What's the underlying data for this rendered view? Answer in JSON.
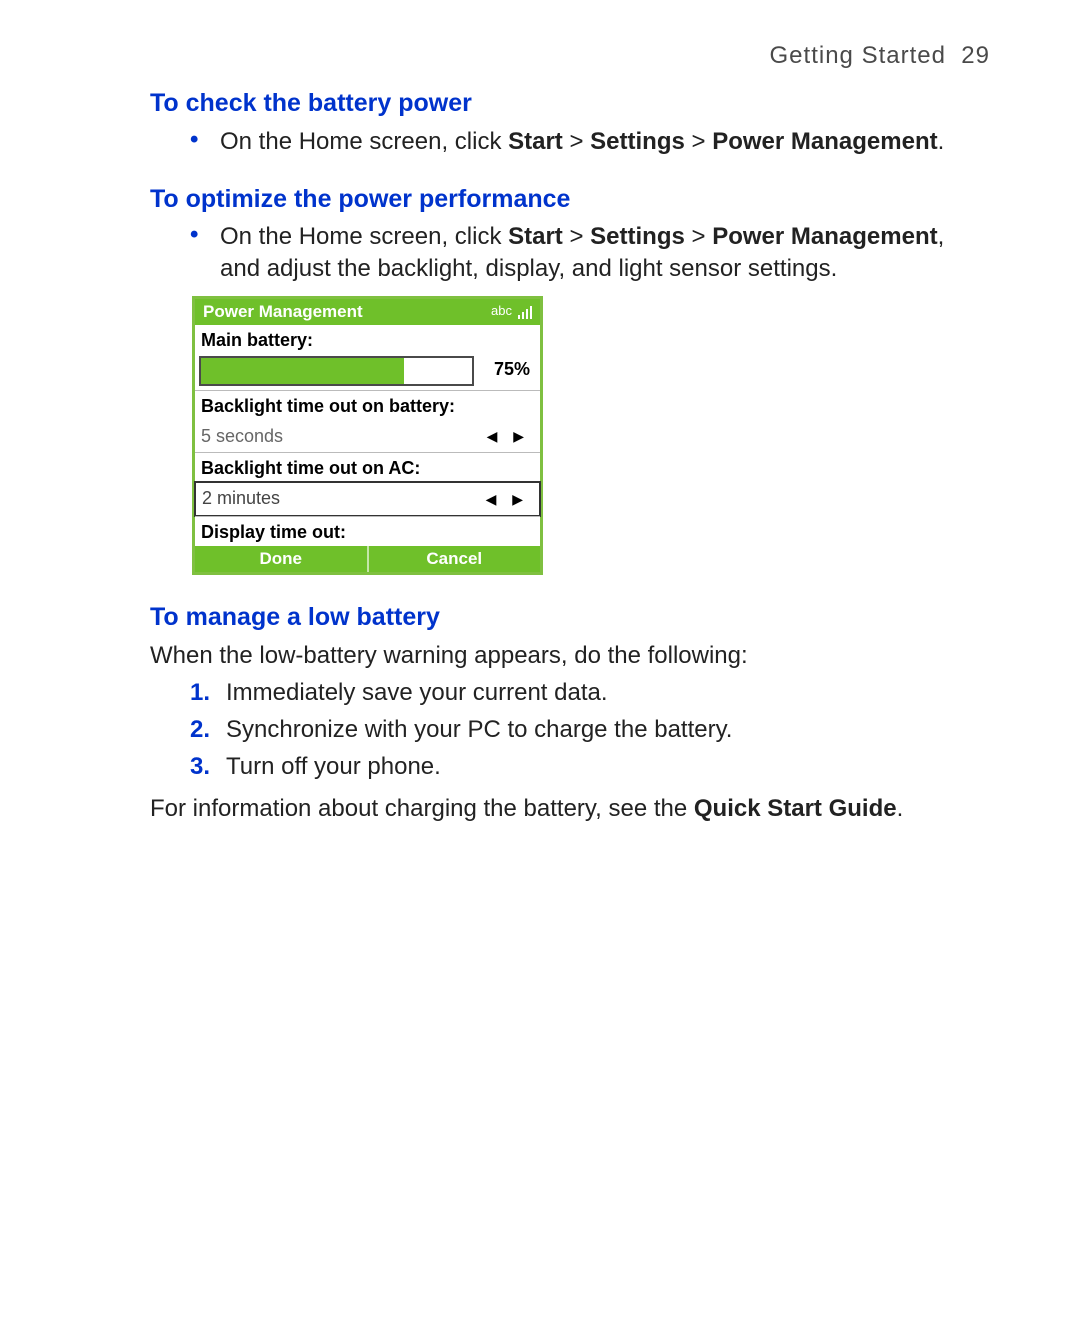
{
  "header": {
    "section": "Getting Started",
    "page": "29"
  },
  "h1": "To check the battery power",
  "b1_pre": "On the Home screen, click ",
  "b1_a": "Start",
  "gt": " > ",
  "b1_b": "Settings",
  "b1_c": "Power Management",
  "b1_post": ".",
  "h2": "To optimize the power performance",
  "b2_pre": "On the Home screen, click ",
  "b2_post_a": ", and adjust the backlight, display, and light sensor settings.",
  "device": {
    "title": "Power Management",
    "abc": "abc",
    "main_battery_label": "Main battery:",
    "battery_pct_value": 75,
    "battery_pct_text": "75%",
    "backlight_batt_label": "Backlight time out on battery:",
    "backlight_batt_value": "5 seconds",
    "backlight_ac_label": "Backlight time out on AC:",
    "backlight_ac_value": "2 minutes",
    "display_timeout_label": "Display time out:",
    "done": "Done",
    "cancel": "Cancel"
  },
  "h3": "To manage a low battery",
  "p3_intro": "When the low-battery warning appears, do the following:",
  "steps": {
    "n1": "1.",
    "t1": "Immediately save your current data.",
    "n2": "2.",
    "t2": "Synchronize with your PC to charge the battery.",
    "n3": "3.",
    "t3": "Turn off your phone."
  },
  "p3_outro_a": "For information about charging the battery, see the ",
  "p3_outro_b": "Quick Start Guide",
  "p3_outro_c": "."
}
